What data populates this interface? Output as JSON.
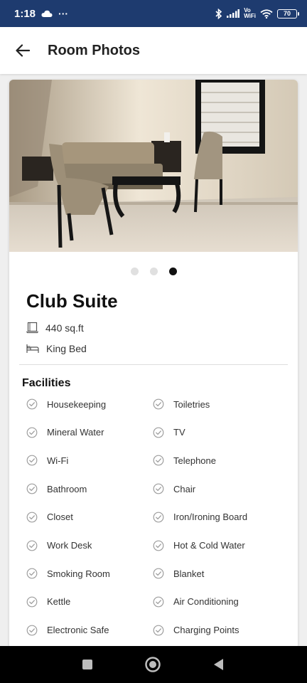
{
  "status_bar": {
    "time": "1:18",
    "more": "···",
    "wifi_label_top": "Vo",
    "wifi_label_bottom": "WiFi",
    "battery": "70"
  },
  "header": {
    "title": "Room Photos"
  },
  "gallery": {
    "total_photos": 3,
    "active_index": 2
  },
  "room": {
    "name": "Club Suite",
    "size": "440 sq.ft",
    "bed": "King Bed"
  },
  "facilities": {
    "title": "Facilities",
    "items": [
      "Housekeeping",
      "Toiletries",
      "Mineral Water",
      "TV",
      "Wi-Fi",
      "Telephone",
      "Bathroom",
      "Chair",
      "Closet",
      "Iron/Ironing Board",
      "Work Desk",
      "Hot & Cold Water",
      "Smoking Room",
      "Blanket",
      "Kettle",
      "Air Conditioning",
      "Electronic Safe",
      "Charging Points"
    ]
  },
  "colors": {
    "status_bar": "#1e3b6f",
    "check_icon": "#9e9e9e"
  }
}
